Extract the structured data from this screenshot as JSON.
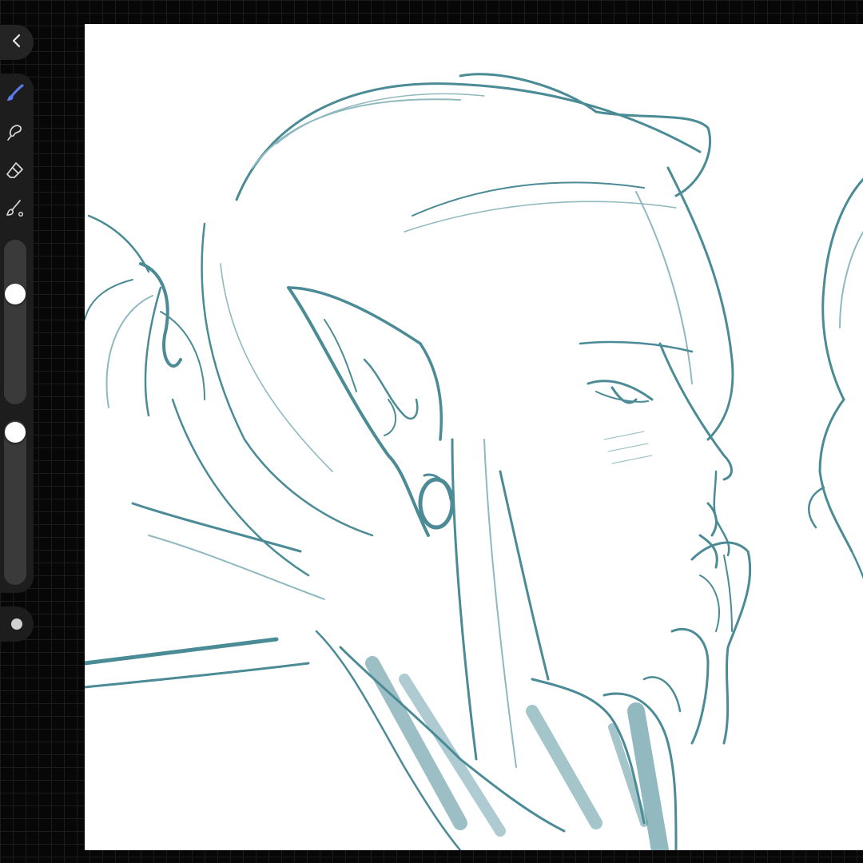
{
  "app": {
    "colors": {
      "stroke": "#4a8b96",
      "stroke_light": "#8fb9bf",
      "canvas": "#ffffff",
      "active_tool": "#5b7cf0",
      "toolbar_bg": "#1d1d1d",
      "workspace_bg": "#070707"
    }
  },
  "toolbar": {
    "back_icon": "chevron-left-icon",
    "tools": [
      {
        "id": "brush",
        "icon": "brush-icon",
        "active": true
      },
      {
        "id": "smudge",
        "icon": "smudge-icon",
        "active": false
      },
      {
        "id": "eraser",
        "icon": "eraser-icon",
        "active": false
      },
      {
        "id": "paint-bucket",
        "icon": "fill-brush-icon",
        "active": false
      }
    ],
    "brush_size_level": 0.3,
    "brush_opacity_level": 0.0,
    "modifier_icon": "modifier-dot-icon"
  }
}
